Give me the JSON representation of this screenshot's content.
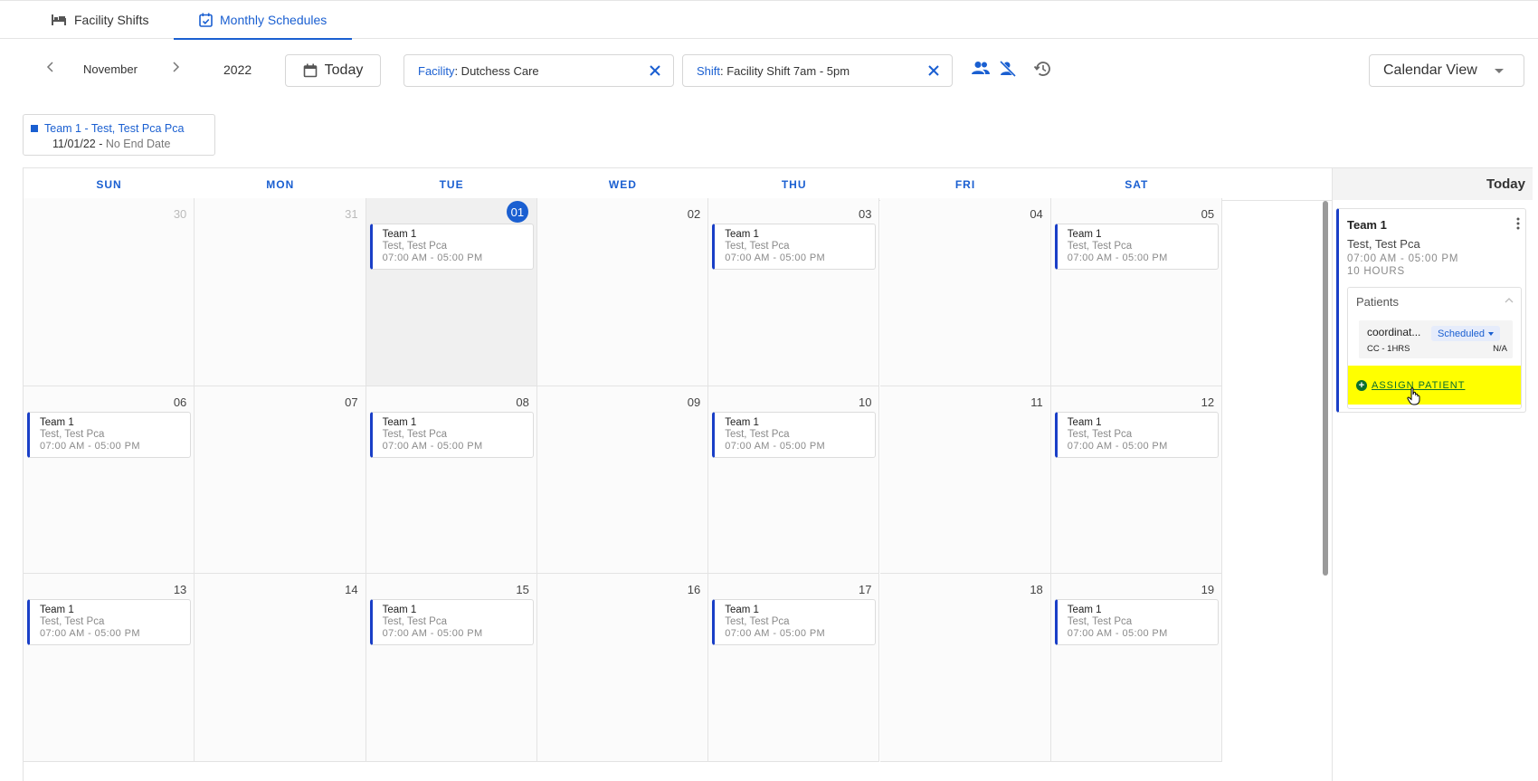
{
  "tabs": [
    {
      "label": "Facility Shifts",
      "icon": "bed-icon"
    },
    {
      "label": "Monthly Schedules",
      "icon": "calendar-check-icon",
      "active": true
    }
  ],
  "toolbar": {
    "month": "November",
    "year": "2022",
    "today_label": "Today",
    "facility_key": "Facility",
    "facility_value": ": Dutchess Care",
    "shift_key": "Shift",
    "shift_value": ": Facility Shift 7am - 5pm",
    "view_label": "Calendar View"
  },
  "legend": {
    "title": "Team 1 - Test, Test Pca Pca",
    "start": "11/01/22",
    "sep": " - ",
    "end": "No End Date"
  },
  "calendar": {
    "day_names": [
      "SUN",
      "MON",
      "TUE",
      "WED",
      "THU",
      "FRI",
      "SAT"
    ],
    "event": {
      "team": "Team 1",
      "name": "Test, Test Pca",
      "time": "07:00 AM - 05:00 PM"
    },
    "weeks": [
      [
        {
          "date": "30",
          "muted": true
        },
        {
          "date": "31",
          "muted": true
        },
        {
          "date": "01",
          "today": true,
          "event": true
        },
        {
          "date": "02"
        },
        {
          "date": "03",
          "event": true
        },
        {
          "date": "04"
        },
        {
          "date": "05",
          "event": true
        }
      ],
      [
        {
          "date": "06",
          "event": true
        },
        {
          "date": "07"
        },
        {
          "date": "08",
          "event": true
        },
        {
          "date": "09"
        },
        {
          "date": "10",
          "event": true
        },
        {
          "date": "11"
        },
        {
          "date": "12",
          "event": true
        }
      ],
      [
        {
          "date": "13",
          "event": true
        },
        {
          "date": "14"
        },
        {
          "date": "15",
          "event": true
        },
        {
          "date": "16"
        },
        {
          "date": "17",
          "event": true
        },
        {
          "date": "18"
        },
        {
          "date": "19",
          "event": true
        }
      ]
    ]
  },
  "side_panel": {
    "header": "Today",
    "card": {
      "team": "Team 1",
      "name": "Test, Test Pca",
      "time": "07:00 AM - 05:00 PM",
      "hours": "10 HOURS",
      "patients_label": "Patients",
      "patient": {
        "name": "coordinat...",
        "status": "Scheduled",
        "code": "CC - 1HRS",
        "value": "N/A"
      },
      "assign_label": "ASSIGN PATIENT",
      "highlight_color": "#ffff00"
    }
  },
  "colors": {
    "accent": "#1a5fd1",
    "event_border": "#1a3fc7",
    "assign_text": "#0a6e2e"
  }
}
